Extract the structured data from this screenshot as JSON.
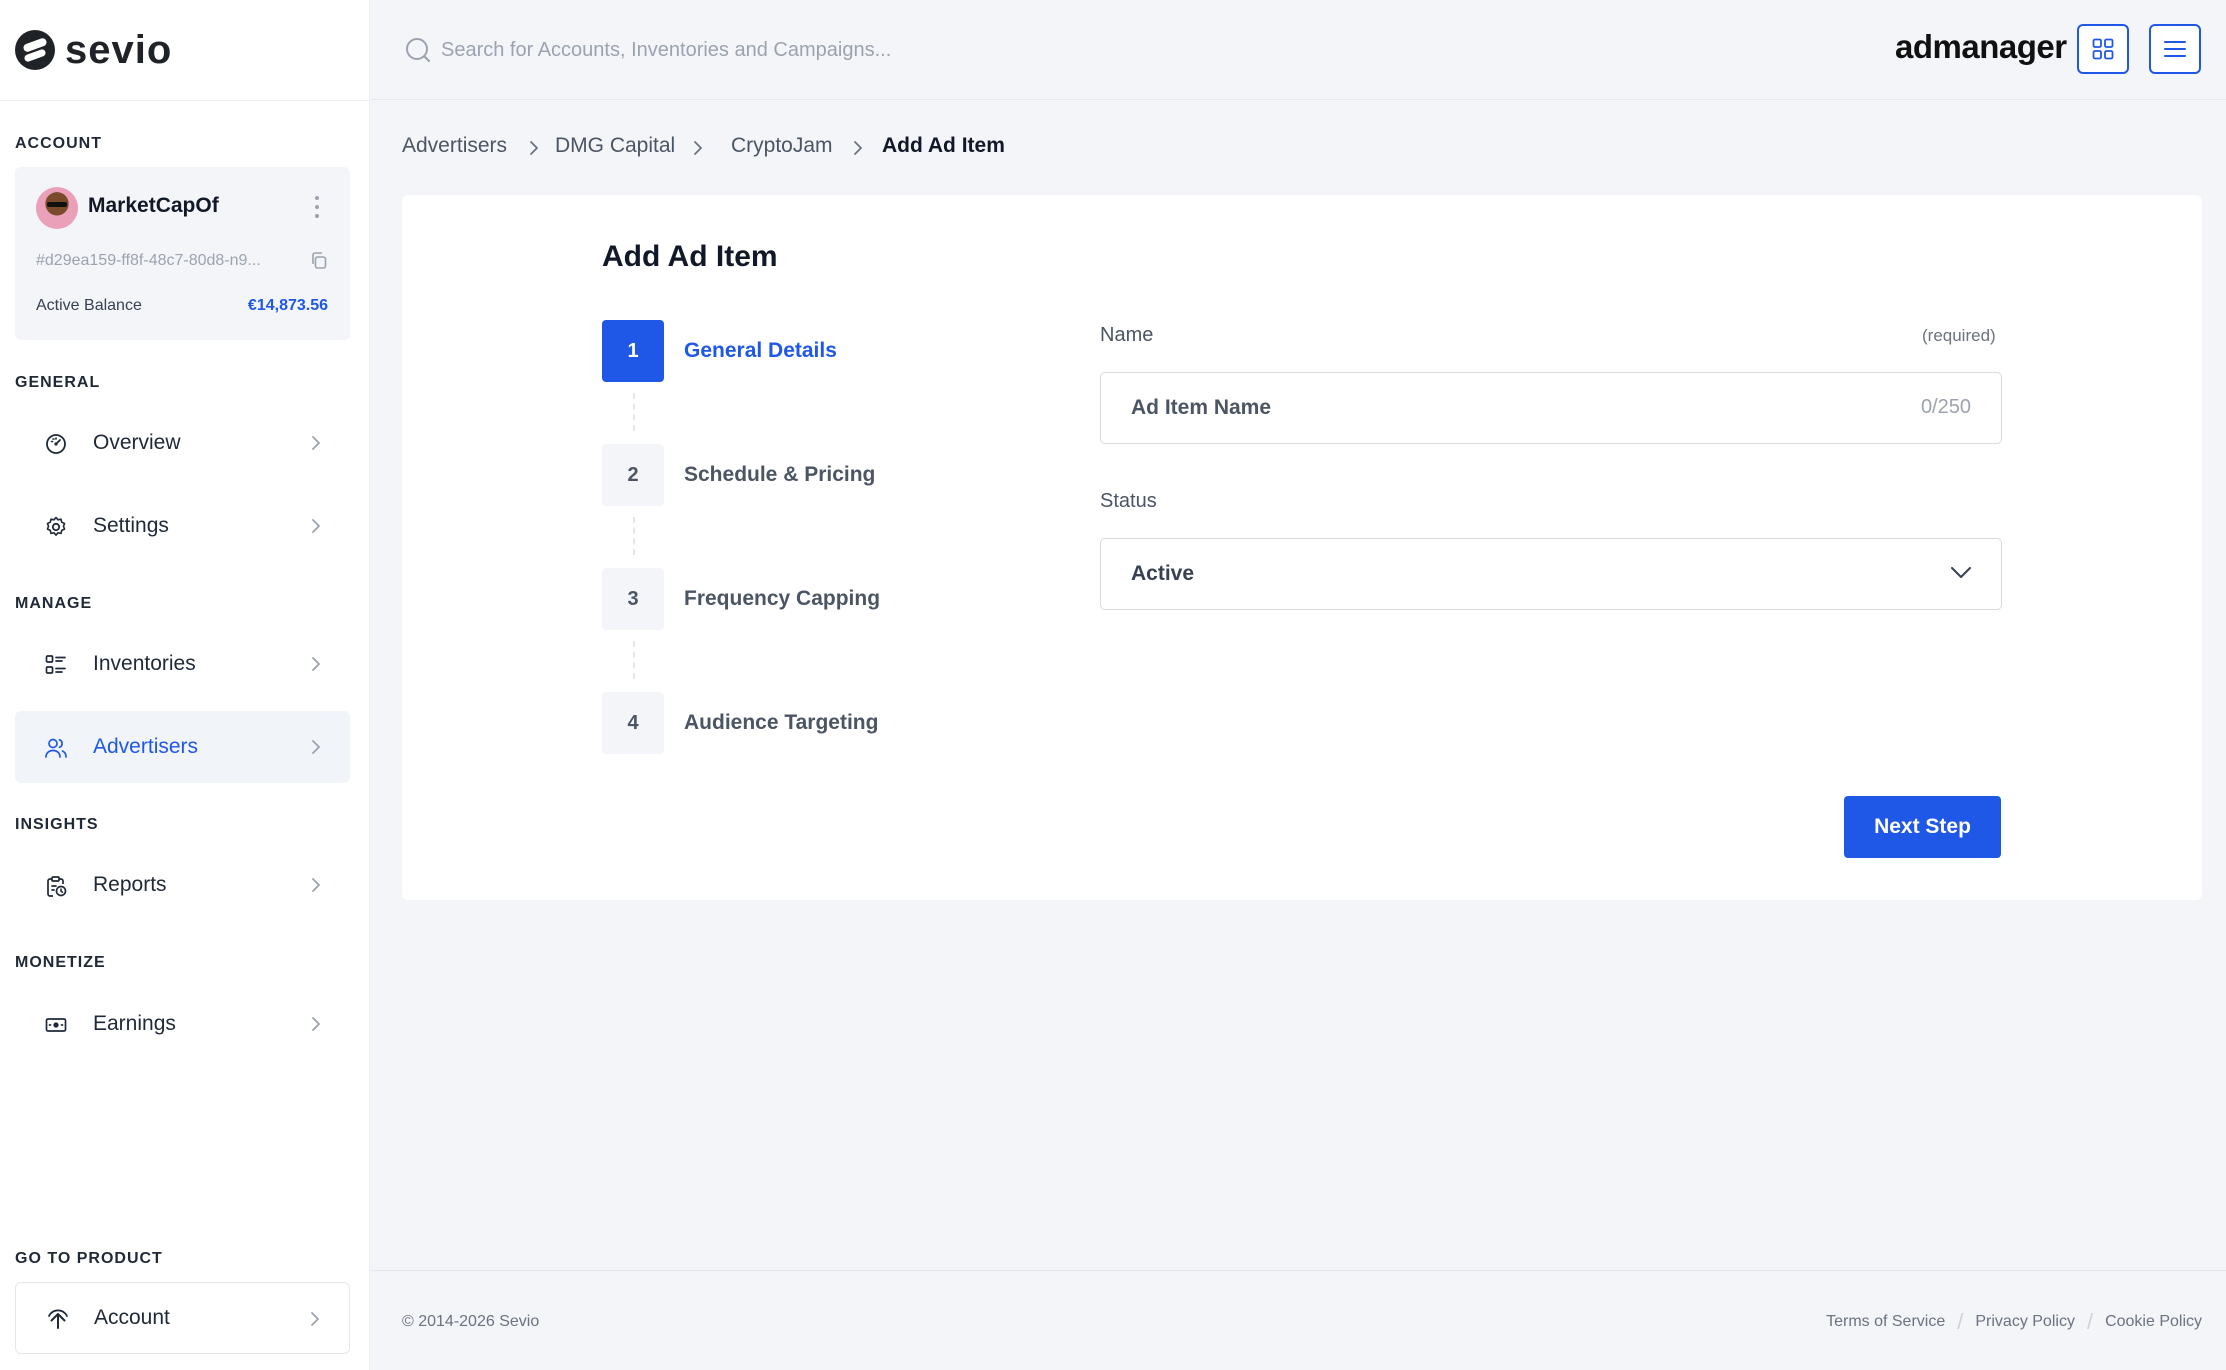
{
  "sidebar": {
    "logo_text": "sevio",
    "sections": {
      "account": "ACCOUNT",
      "general": "GENERAL",
      "manage": "MANAGE",
      "insights": "INSIGHTS",
      "monetize": "MONETIZE",
      "go_to_product": "GO TO PRODUCT"
    },
    "account": {
      "name": "MarketCapOf",
      "id": "#d29ea159-ff8f-48c7-80d8-n9...",
      "balance_label": "Active Balance",
      "balance_value": "€14,873.56"
    },
    "nav": {
      "overview": {
        "label": "Overview",
        "icon": "dashboard-icon"
      },
      "settings": {
        "label": "Settings",
        "icon": "gear-icon"
      },
      "inventories": {
        "label": "Inventories",
        "icon": "list-icon"
      },
      "advertisers": {
        "label": "Advertisers",
        "icon": "users-icon",
        "active": true
      },
      "reports": {
        "label": "Reports",
        "icon": "report-icon"
      },
      "earnings": {
        "label": "Earnings",
        "icon": "money-icon"
      }
    },
    "go_to_product": {
      "label": "Account",
      "icon": "upload-arrow-icon"
    }
  },
  "topbar": {
    "search_placeholder": "Search for Accounts, Inventories and Campaigns...",
    "brand": "admanager"
  },
  "breadcrumb": [
    "Advertisers",
    "DMG Capital",
    "CryptoJam",
    "Add Ad Item"
  ],
  "form": {
    "title": "Add Ad Item",
    "steps": [
      {
        "number": "1",
        "label": "General Details",
        "active": true
      },
      {
        "number": "2",
        "label": "Schedule & Pricing",
        "active": false
      },
      {
        "number": "3",
        "label": "Frequency Capping",
        "active": false
      },
      {
        "number": "4",
        "label": "Audience Targeting",
        "active": false
      }
    ],
    "name_label": "Name",
    "name_required": "(required)",
    "name_placeholder": "Ad Item Name",
    "name_counter": "0/250",
    "status_label": "Status",
    "status_value": "Active",
    "next_button": "Next Step"
  },
  "footer": {
    "copyright": "© 2014-2026 Sevio",
    "links": [
      "Terms of Service",
      "Privacy Policy",
      "Cookie Policy"
    ]
  },
  "colors": {
    "accent": "#1f57e6",
    "background": "#f3f5f9",
    "text": "#1f2937"
  }
}
